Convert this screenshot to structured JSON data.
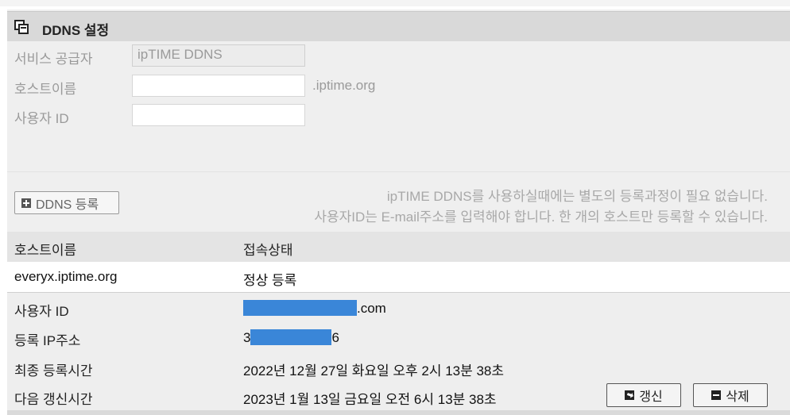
{
  "header": {
    "title": "DDNS 설정",
    "icon": "window-stack-icon"
  },
  "form": {
    "provider_label": "서비스 공급자",
    "provider_value": "ipTIME DDNS",
    "host_label": "호스트이름",
    "host_value": "",
    "host_suffix": ".iptime.org",
    "user_label": "사용자 ID",
    "user_value": ""
  },
  "register_button": {
    "label": "DDNS 등록",
    "icon": "plus-box-icon"
  },
  "notes": {
    "line1": "ipTIME DDNS를 사용하실때에는 별도의 등록과정이 필요 없습니다.",
    "line2": "사용자ID는 E-mail주소를 입력해야 합니다. 한 개의 호스트만 등록할 수 있습니다."
  },
  "table": {
    "headers": {
      "host": "호스트이름",
      "status": "접속상태"
    },
    "row": {
      "host": "everyx.iptime.org",
      "status": "정상 등록"
    }
  },
  "details": {
    "user_label": "사용자 ID",
    "user_value_suffix": ".com",
    "ip_label": "등록 IP주소",
    "ip_prefix": "3",
    "ip_suffix": "6",
    "last_label": "최종 등록시간",
    "last_value": "2022년 12월 27일 화요일 오후 2시 13분 38초",
    "next_label": "다음 갱신시간",
    "next_value": "2023년 1월 13일 금요일 오전 6시 13분 38초"
  },
  "actions": {
    "renew_label": "갱신",
    "renew_icon": "refresh-box-icon",
    "delete_label": "삭제",
    "delete_icon": "minus-box-icon"
  },
  "colors": {
    "redaction": "#3a86d8",
    "header_bg": "#d9d9d9",
    "panel_bg": "#efefef"
  }
}
